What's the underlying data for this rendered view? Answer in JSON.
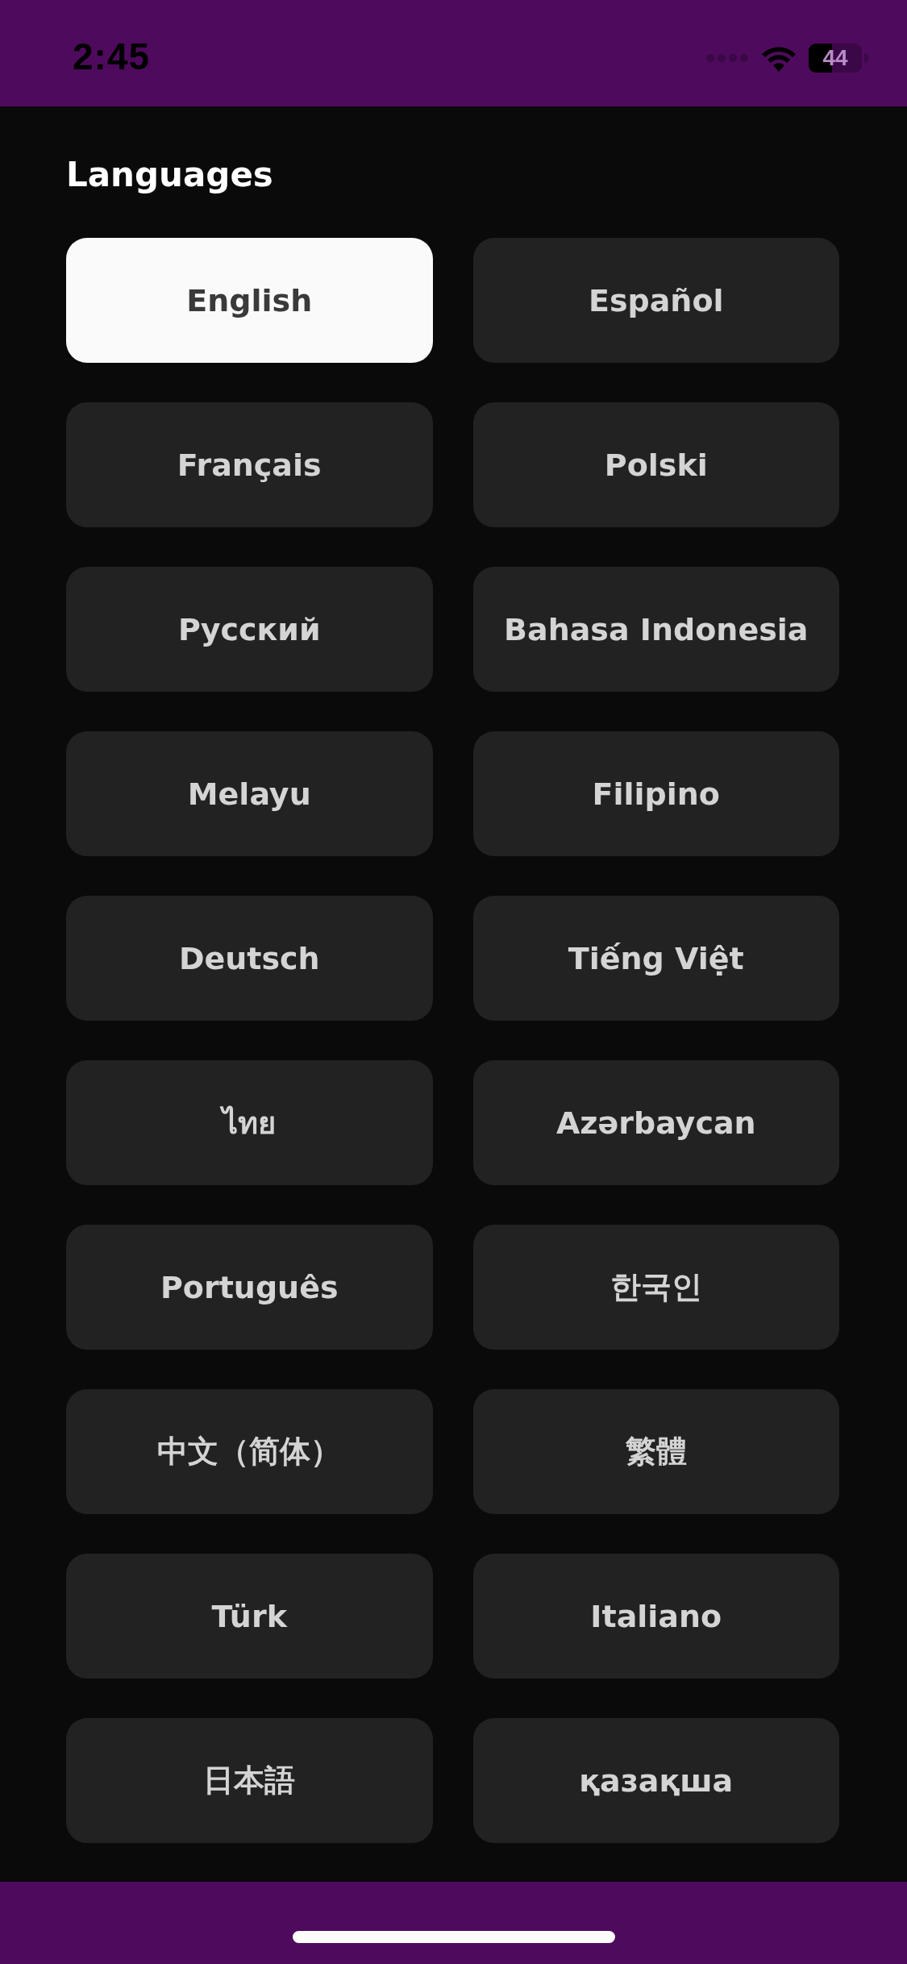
{
  "status_bar": {
    "time": "2:45",
    "battery": "44"
  },
  "title": "Languages",
  "languages": [
    {
      "label": "English",
      "selected": true
    },
    {
      "label": "Español",
      "selected": false
    },
    {
      "label": "Français",
      "selected": false
    },
    {
      "label": "Polski",
      "selected": false
    },
    {
      "label": "Русский",
      "selected": false
    },
    {
      "label": "Bahasa Indonesia",
      "selected": false
    },
    {
      "label": "Melayu",
      "selected": false
    },
    {
      "label": "Filipino",
      "selected": false
    },
    {
      "label": "Deutsch",
      "selected": false
    },
    {
      "label": "Tiếng Việt",
      "selected": false
    },
    {
      "label": "ไทย",
      "selected": false
    },
    {
      "label": "Azərbaycan",
      "selected": false
    },
    {
      "label": "Português",
      "selected": false
    },
    {
      "label": "한국인",
      "selected": false
    },
    {
      "label": "中文（简体）",
      "selected": false
    },
    {
      "label": "繁體",
      "selected": false
    },
    {
      "label": "Türk",
      "selected": false
    },
    {
      "label": "Italiano",
      "selected": false
    },
    {
      "label": "日本語",
      "selected": false
    },
    {
      "label": "қазақша",
      "selected": false
    }
  ]
}
